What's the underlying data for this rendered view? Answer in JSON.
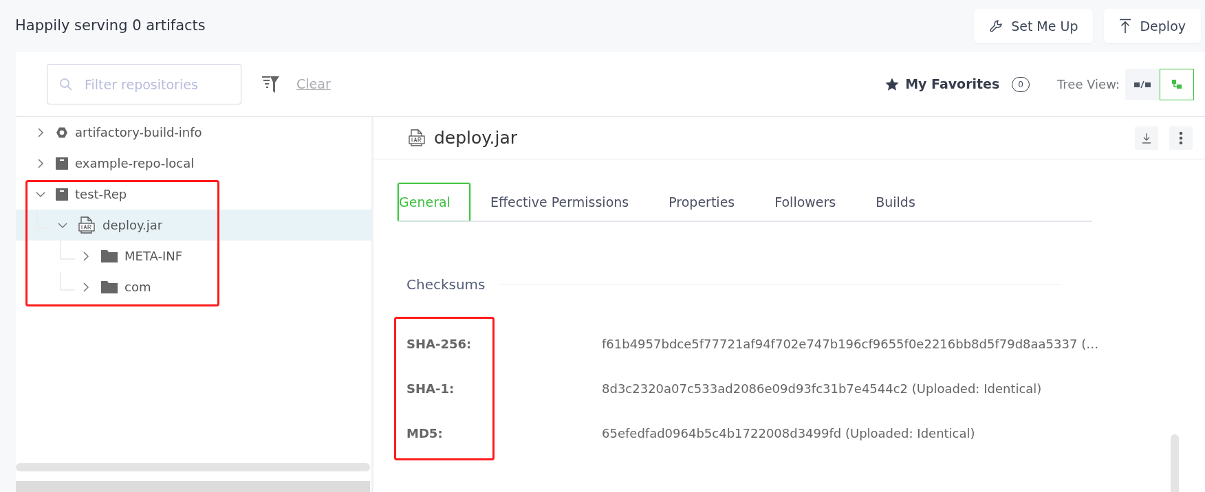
{
  "header": {
    "title": "Happily serving 0 artifacts",
    "buttons": [
      {
        "kind": "setup",
        "label": "Set Me Up"
      },
      {
        "kind": "deploy",
        "label": "Deploy"
      }
    ]
  },
  "toolbar": {
    "filter": {
      "placeholder": "Filter repositories"
    },
    "clear": "Clear",
    "favorites": {
      "label": "My Favorites",
      "count": "0"
    },
    "tree_view_label": "Tree View:",
    "view_toggles": [
      {
        "kind": "flat",
        "selected": false
      },
      {
        "kind": "tree",
        "selected": true
      }
    ]
  },
  "tree": [
    {
      "label": "artifactory-build-info",
      "kind": "build",
      "expanded": false,
      "selected": false,
      "highlighted": false
    },
    {
      "label": "example-repo-local",
      "kind": "repo",
      "expanded": false,
      "selected": false,
      "highlighted": false
    },
    {
      "label": "test-Rep",
      "kind": "repo",
      "expanded": true,
      "selected": false,
      "highlighted": true,
      "children": [
        {
          "label": "deploy.jar",
          "kind": "jar",
          "expanded": true,
          "selected": true,
          "children": [
            {
              "label": "META-INF",
              "kind": "folder",
              "expanded": false,
              "selected": false
            },
            {
              "label": "com",
              "kind": "folder",
              "expanded": false,
              "selected": false
            }
          ]
        }
      ]
    }
  ],
  "detail": {
    "title": "deploy.jar",
    "tabs": [
      {
        "label": "General",
        "selected": true
      },
      {
        "label": "Effective Permissions",
        "selected": false
      },
      {
        "label": "Properties",
        "selected": false
      },
      {
        "label": "Followers",
        "selected": false
      },
      {
        "label": "Builds",
        "selected": false
      }
    ],
    "section_title": "Checksums",
    "labels_highlighted": true,
    "checksums": [
      {
        "label": "SHA-256:",
        "value": "f61b4957bdce5f77721af94f702e747b196cf9655f0e2216bb8d5f79d8aa5337 (…"
      },
      {
        "label": "SHA-1:",
        "value": "8d3c2320a07c533ad2086e09d93fc31b7e4544c2 (Uploaded: Identical)"
      },
      {
        "label": "MD5:",
        "value": "65efedfad0964b5c4b1722008d3499fd (Uploaded: Identical)"
      }
    ]
  }
}
